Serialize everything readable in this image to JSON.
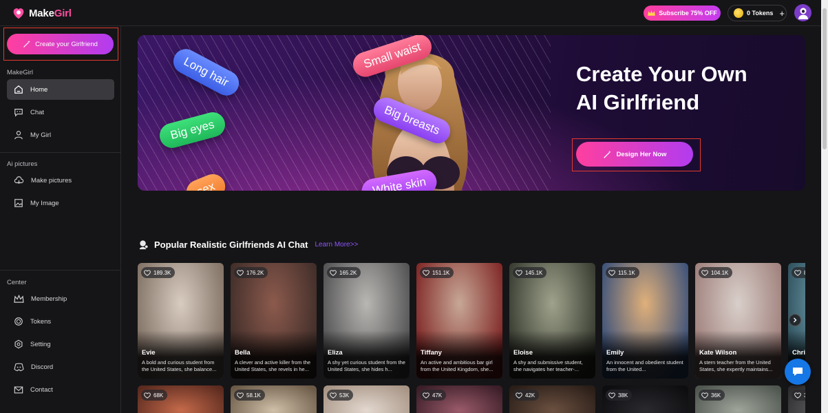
{
  "header": {
    "logo_text_1": "Make",
    "logo_text_2": "Girl",
    "subscribe_label": "Subscribe 75% OFF",
    "tokens_label": "0 Tokens",
    "plus": "+"
  },
  "sidebar": {
    "create_label": "Create your Girlfriend",
    "section1_title": "MakeGirl",
    "section1_items": [
      {
        "label": "Home",
        "icon": "home-icon"
      },
      {
        "label": "Chat",
        "icon": "chat-icon"
      },
      {
        "label": "My Girl",
        "icon": "user-icon"
      }
    ],
    "section2_title": "Ai pictures",
    "section2_items": [
      {
        "label": "Make pictures",
        "icon": "cloud-image-icon"
      },
      {
        "label": "My Image",
        "icon": "image-icon"
      }
    ],
    "section3_title": "Center",
    "section3_items": [
      {
        "label": "Membership",
        "icon": "crown-icon"
      },
      {
        "label": "Tokens",
        "icon": "coin-icon"
      },
      {
        "label": "Setting",
        "icon": "gear-icon"
      },
      {
        "label": "Discord",
        "icon": "discord-icon"
      },
      {
        "label": "Contact",
        "icon": "mail-icon"
      }
    ]
  },
  "hero": {
    "title_line1": "Create Your Own",
    "title_line2": "AI Girlfriend",
    "cta_label": "Design Her Now",
    "tags": [
      "Long hair",
      "Small waist",
      "Big breasts",
      "Big eyes",
      "sex",
      "White skin"
    ]
  },
  "popular": {
    "title": "Popular Realistic Girlfriends AI Chat",
    "learn_more": "Learn More>>",
    "cards": [
      {
        "likes": "189.3K",
        "name": "Evie",
        "desc": "A bold and curious student from the United States, she balance...",
        "color1": "#d8cbbf",
        "color2": "#7a6a5e"
      },
      {
        "likes": "176.2K",
        "name": "Bella",
        "desc": "A clever and active killer from the United States, she revels in he...",
        "color1": "#8c5a4d",
        "color2": "#3a2a26"
      },
      {
        "likes": "165.2K",
        "name": "Eliza",
        "desc": "A shy yet curious student from the United States, she hides h...",
        "color1": "#b9b7b3",
        "color2": "#4a4a4c"
      },
      {
        "likes": "151.1K",
        "name": "Tiffany",
        "desc": "An active and ambitious bar girl from the United Kingdom, she...",
        "color1": "#c7a796",
        "color2": "#7a1d1d"
      },
      {
        "likes": "145.1K",
        "name": "Eloise",
        "desc": "A shy and submissive student, she navigates her teacher-...",
        "color1": "#9fa38c",
        "color2": "#2f3329"
      },
      {
        "likes": "115.1K",
        "name": "Emily",
        "desc": "An innocent and obedient student from the United...",
        "color1": "#e0b07a",
        "color2": "#2e4a7a"
      },
      {
        "likes": "104.1K",
        "name": "Kate Wilson",
        "desc": "A stern teacher from the United States, she expertly maintains...",
        "color1": "#d9cfca",
        "color2": "#9b7a76"
      },
      {
        "likes": "8",
        "name": "Chri",
        "desc": "",
        "color1": "#7fb0c0",
        "color2": "#2a4a56"
      }
    ],
    "row2": [
      {
        "likes": "68K",
        "color1": "#c56a4a",
        "color2": "#5a2a1f"
      },
      {
        "likes": "58.1K",
        "color1": "#cfbfa8",
        "color2": "#6b5a47"
      },
      {
        "likes": "53K",
        "color1": "#e3d8cf",
        "color2": "#a79485"
      },
      {
        "likes": "47K",
        "color1": "#9a5a6a",
        "color2": "#3b1e28"
      },
      {
        "likes": "42K",
        "color1": "#6b5040",
        "color2": "#2a1e18"
      },
      {
        "likes": "38K",
        "color1": "#2a2a2e",
        "color2": "#0d0d10"
      },
      {
        "likes": "36K",
        "color1": "#9fa59a",
        "color2": "#4f5650"
      },
      {
        "likes": "3",
        "color1": "#6a6a6c",
        "color2": "#2c2c2e"
      }
    ]
  }
}
